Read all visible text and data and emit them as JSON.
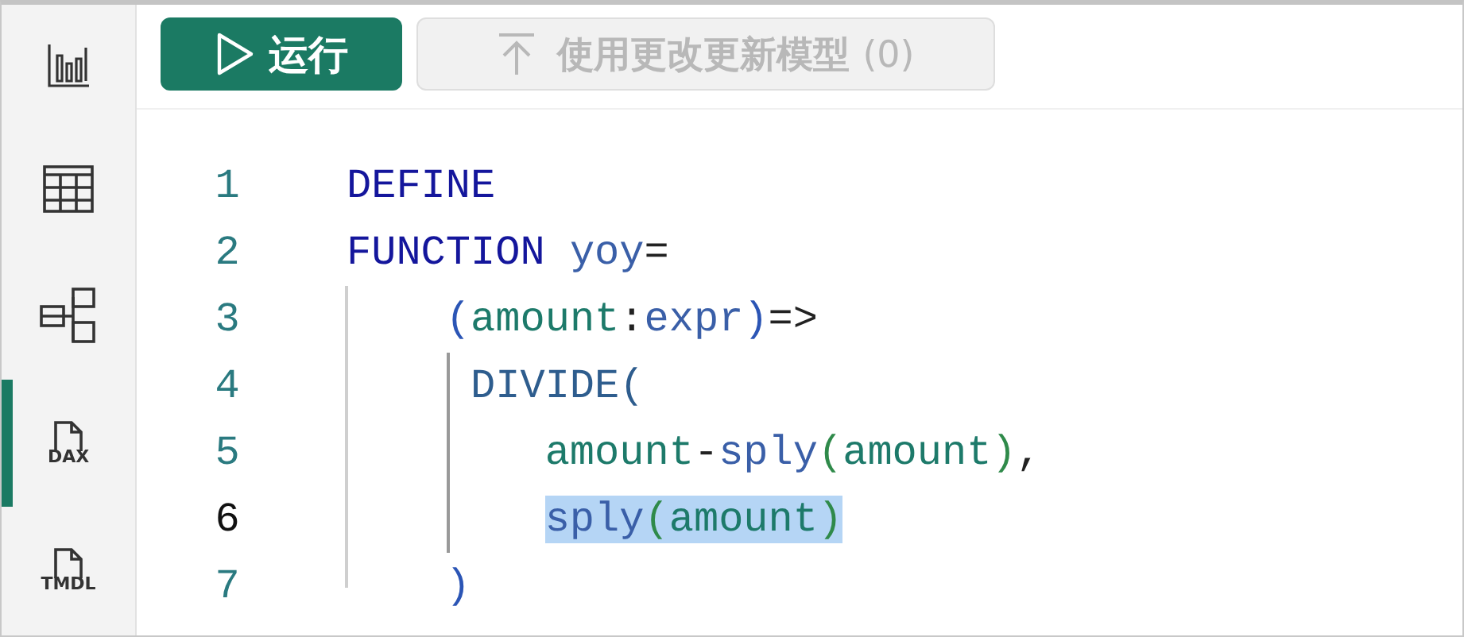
{
  "sidebar": {
    "items": [
      {
        "kind": "chart",
        "selected": false
      },
      {
        "kind": "table",
        "selected": false
      },
      {
        "kind": "model",
        "selected": false
      },
      {
        "kind": "dax",
        "label": "DAX",
        "selected": true
      },
      {
        "kind": "tmdl",
        "label": "TMDL",
        "selected": false
      }
    ]
  },
  "toolbar": {
    "run_button": {
      "label": "运行",
      "disabled": false
    },
    "apply_button": {
      "label": "使用更改更新模型",
      "count": "(0)",
      "disabled": true
    }
  },
  "editor": {
    "lines": [
      {
        "number": "1",
        "current": false,
        "tokens": [
          {
            "text": "DEFINE",
            "kind": "keyword",
            "selected": false
          }
        ]
      },
      {
        "number": "2",
        "current": false,
        "tokens": [
          {
            "text": "FUNCTION",
            "kind": "keyword",
            "selected": false
          },
          {
            "text": " yoy",
            "kind": "name",
            "selected": false
          },
          {
            "text": "=",
            "kind": "punct",
            "selected": false
          }
        ]
      },
      {
        "number": "3",
        "current": false,
        "tokens": [
          {
            "text": "    (",
            "kind": "paren1",
            "selected": false
          },
          {
            "text": "amount",
            "kind": "param",
            "selected": false
          },
          {
            "text": ":",
            "kind": "punct",
            "selected": false
          },
          {
            "text": "expr",
            "kind": "name",
            "selected": false
          },
          {
            "text": ")",
            "kind": "paren1",
            "selected": false
          },
          {
            "text": "=>",
            "kind": "punct",
            "selected": false
          }
        ]
      },
      {
        "number": "4",
        "current": false,
        "tokens": [
          {
            "text": "     DIVIDE(",
            "kind": "func",
            "selected": false
          }
        ]
      },
      {
        "number": "5",
        "current": false,
        "tokens": [
          {
            "text": "        amount",
            "kind": "param",
            "selected": false
          },
          {
            "text": "-",
            "kind": "punct",
            "selected": false
          },
          {
            "text": "sply",
            "kind": "name",
            "selected": false
          },
          {
            "text": "(",
            "kind": "paren2",
            "selected": false
          },
          {
            "text": "amount",
            "kind": "param",
            "selected": false
          },
          {
            "text": ")",
            "kind": "paren2",
            "selected": false
          },
          {
            "text": ",",
            "kind": "punct",
            "selected": false
          }
        ]
      },
      {
        "number": "6",
        "current": true,
        "tokens": [
          {
            "text": "        sply",
            "kind": "name",
            "selected": true
          },
          {
            "text": "(",
            "kind": "paren2",
            "selected": true
          },
          {
            "text": "amount",
            "kind": "param",
            "selected": true
          },
          {
            "text": ")",
            "kind": "paren2",
            "selected": true
          }
        ]
      },
      {
        "number": "7",
        "current": false,
        "tokens": [
          {
            "text": "    )",
            "kind": "paren1",
            "selected": false
          }
        ]
      }
    ]
  }
}
